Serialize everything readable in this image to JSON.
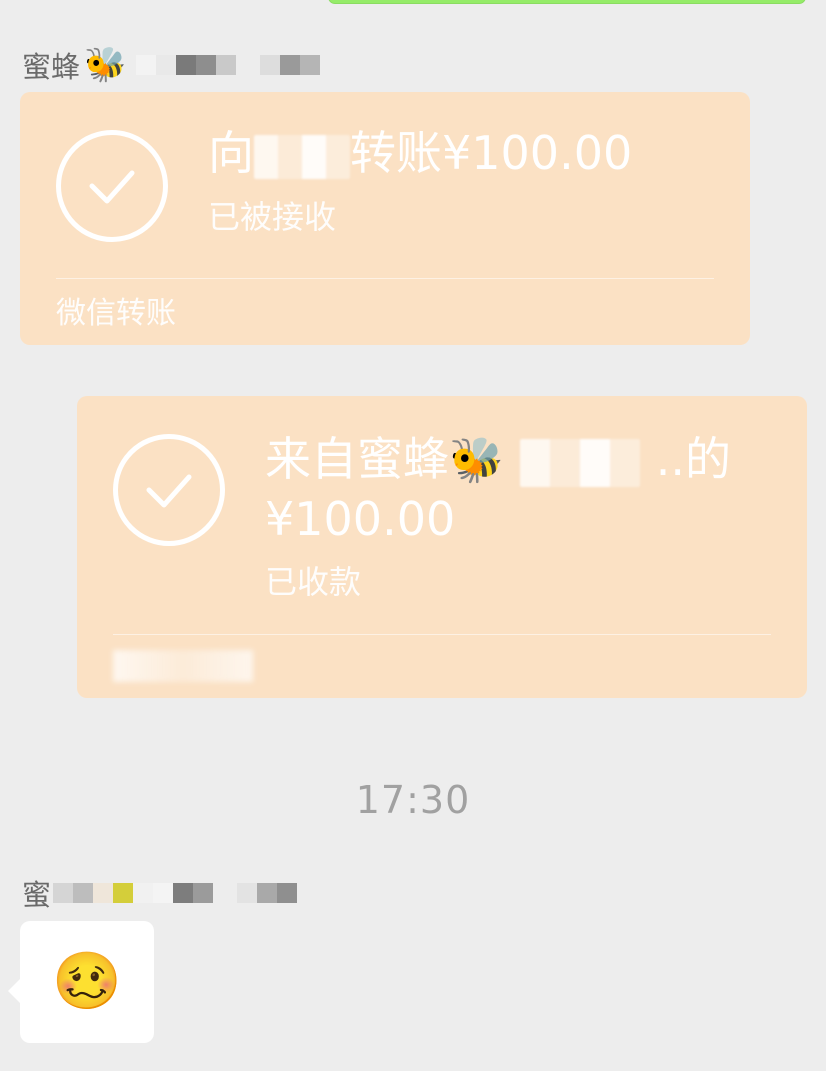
{
  "sender1": {
    "name": "蜜蜂",
    "emoji": "🐝"
  },
  "transfer_sent": {
    "title_prefix": "向",
    "title_suffix": "转账¥100.00",
    "status": "已被接收",
    "footer": "微信转账",
    "icon": "check-circle-icon"
  },
  "transfer_received": {
    "title_prefix": "来自蜜蜂",
    "title_emoji": "🐝",
    "title_suffix": "..的",
    "amount": "¥100.00",
    "status": "已收款",
    "icon": "check-circle-icon"
  },
  "timestamp": "17:30",
  "sender2": {
    "name_prefix": "蜜"
  },
  "sticker": {
    "emoji": "🥴",
    "icon": "emoji-sticker"
  },
  "colors": {
    "chat_background": "#ededed",
    "transfer_bubble": "#fbe1c4",
    "outgoing_green": "#95ec69",
    "incoming_bubble": "#ffffff",
    "timestamp_text": "#a1a1a1"
  }
}
